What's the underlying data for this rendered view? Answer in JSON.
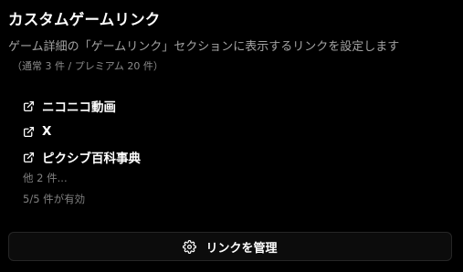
{
  "section": {
    "title": "カスタムゲームリンク",
    "description": "ゲーム詳細の「ゲームリンク」セクションに表示するリンクを設定します",
    "counts": "（通常 3 件 / プレミアム 20 件）"
  },
  "links": [
    {
      "label": "ニコニコ動画",
      "icon": "external-link-icon"
    },
    {
      "label": "X",
      "icon": "external-link-icon"
    },
    {
      "label": "ピクシブ百科事典",
      "icon": "external-link-icon"
    }
  ],
  "more_text": "他 2 件...",
  "active_text": "5/5 件が有効",
  "manage_button": {
    "label": "リンクを管理",
    "icon": "gear-icon"
  }
}
